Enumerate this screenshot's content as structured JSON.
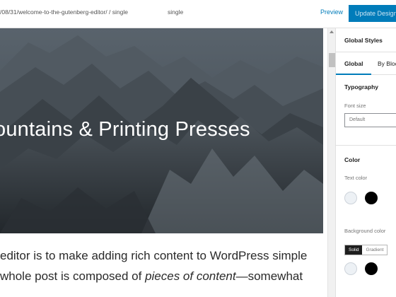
{
  "header": {
    "breadcrumb": "/08/31/welcome-to-the-gutenberg-editor/ / single",
    "template_label": "single",
    "preview_label": "Preview",
    "update_label": "Update Design"
  },
  "editor": {
    "hero_title": "ountains & Printing Presses",
    "paragraph_line1": "editor is to make adding rich content to WordPress simple",
    "paragraph_line2_a": "whole post is composed of ",
    "paragraph_line2_em": "pieces of content",
    "paragraph_line2_b": "—somewhat"
  },
  "sidebar": {
    "title": "Global Styles",
    "tabs": [
      {
        "label": "Global",
        "active": true
      },
      {
        "label": "By Bloc",
        "active": false
      }
    ],
    "typography": {
      "title": "Typography",
      "font_size_label": "Font size",
      "font_size_value": "Default"
    },
    "color": {
      "title": "Color",
      "text_color_label": "Text color",
      "background_color_label": "Background color",
      "toggle_solid": "Solid",
      "toggle_gradient": "Gradient",
      "swatches": [
        "#edf1f5",
        "#000000"
      ]
    }
  },
  "colors": {
    "accent": "#007cba",
    "hero_sky": "#4a5560",
    "hero_rock": "#2f3338"
  }
}
